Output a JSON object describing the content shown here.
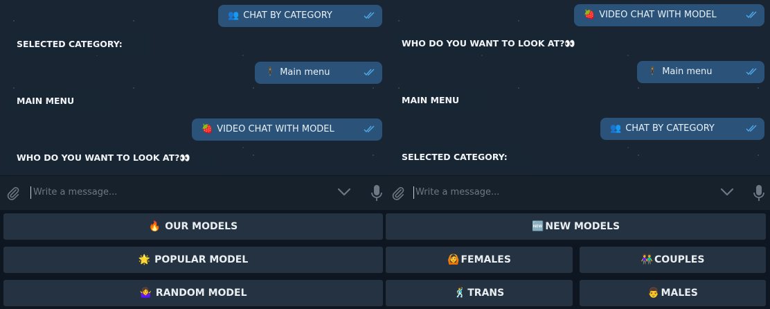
{
  "left": {
    "messages": [
      {
        "dir": "out",
        "emoji": "👥",
        "text": "CHAT BY CATEGORY"
      },
      {
        "dir": "in",
        "text": "SELECTED CATEGORY:"
      },
      {
        "dir": "out",
        "emoji": "🕴",
        "text": "Main menu"
      },
      {
        "dir": "in",
        "text": "MAIN MENU"
      },
      {
        "dir": "out",
        "emoji": "🍓",
        "text": "VIDEO CHAT WITH MODEL"
      },
      {
        "dir": "in",
        "text": "WHO DO YOU WANT TO LOOK AT?👀"
      }
    ],
    "input": {
      "placeholder": "Write a message..."
    },
    "keyboard": [
      {
        "emoji": "🔥",
        "label": "OUR MODELS"
      },
      {
        "emoji": "🌟",
        "label": "POPULAR MODEL"
      },
      {
        "emoji": "🤷‍♀️",
        "label": "RANDOM MODEL"
      }
    ]
  },
  "right": {
    "messages": [
      {
        "dir": "out",
        "emoji": "🍓",
        "text": "VIDEO CHAT WITH MODEL"
      },
      {
        "dir": "in",
        "text": "WHO DO YOU WANT TO LOOK AT?👀"
      },
      {
        "dir": "out",
        "emoji": "🕴",
        "text": "Main menu"
      },
      {
        "dir": "in",
        "text": "MAIN MENU"
      },
      {
        "dir": "out",
        "emoji": "👥",
        "text": "CHAT BY CATEGORY"
      },
      {
        "dir": "in",
        "text": "SELECTED CATEGORY:"
      }
    ],
    "input": {
      "placeholder": "Write a message..."
    },
    "keyboard": [
      {
        "emoji": "🆕",
        "label": "NEW MODELS"
      },
      {
        "emoji": "🙆",
        "label": "FEMALES"
      },
      {
        "emoji": "👫",
        "label": "COUPLES"
      },
      {
        "emoji": "🕺",
        "label": "TRANS"
      },
      {
        "emoji": "👨",
        "label": "MALES"
      }
    ]
  },
  "icons": {
    "attach": "paperclip-icon",
    "scroll": "chevron-down-icon",
    "voice": "microphone-icon",
    "read": "double-check-icon"
  },
  "colors": {
    "outgoing_bubble": "#2b5278",
    "incoming_bubble": "#182533",
    "keyboard_button": "#253241",
    "read_ticks": "#4fa6e8"
  }
}
